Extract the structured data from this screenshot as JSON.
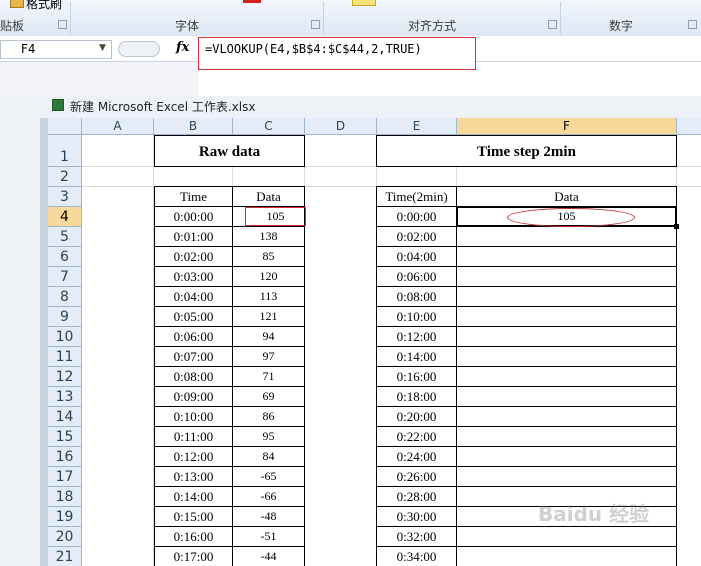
{
  "ribbon": {
    "clipboard_group": "贴板",
    "font_group": "字体",
    "alignment_group": "对齐方式",
    "number_group": "数字",
    "format_painter": "格式刷"
  },
  "formula_bar": {
    "name_box": "F4",
    "fx_label": "fx",
    "formula": "=VLOOKUP(E4,$B$4:$C$44,2,TRUE)"
  },
  "workbook": {
    "title": "新建 Microsoft Excel 工作表.xlsx"
  },
  "columns": [
    "A",
    "B",
    "C",
    "D",
    "E",
    "F"
  ],
  "rows": [
    "1",
    "2",
    "3",
    "4",
    "5",
    "6",
    "7",
    "8",
    "9",
    "10",
    "11",
    "12",
    "13",
    "14",
    "15",
    "16",
    "17",
    "18",
    "19",
    "20",
    "21"
  ],
  "raw_title": "Raw data",
  "step_title": "Time step 2min",
  "raw_headers": [
    "Time",
    "Data"
  ],
  "step_headers": [
    "Time(2min)",
    "Data"
  ],
  "raw_times": [
    "0:00:00",
    "0:01:00",
    "0:02:00",
    "0:03:00",
    "0:04:00",
    "0:05:00",
    "0:06:00",
    "0:07:00",
    "0:08:00",
    "0:09:00",
    "0:10:00",
    "0:11:00",
    "0:12:00",
    "0:13:00",
    "0:14:00",
    "0:15:00",
    "0:16:00",
    "0:17:00"
  ],
  "raw_values": [
    "105",
    "138",
    "85",
    "120",
    "113",
    "121",
    "94",
    "97",
    "71",
    "69",
    "86",
    "95",
    "84",
    "-65",
    "-66",
    "-48",
    "-51",
    "-44"
  ],
  "step_times": [
    "0:00:00",
    "0:02:00",
    "0:04:00",
    "0:06:00",
    "0:08:00",
    "0:10:00",
    "0:12:00",
    "0:14:00",
    "0:16:00",
    "0:18:00",
    "0:20:00",
    "0:22:00",
    "0:24:00",
    "0:26:00",
    "0:28:00",
    "0:30:00",
    "0:32:00",
    "0:34:00"
  ],
  "step_values": [
    "105"
  ],
  "watermark": "Baidu 经验"
}
